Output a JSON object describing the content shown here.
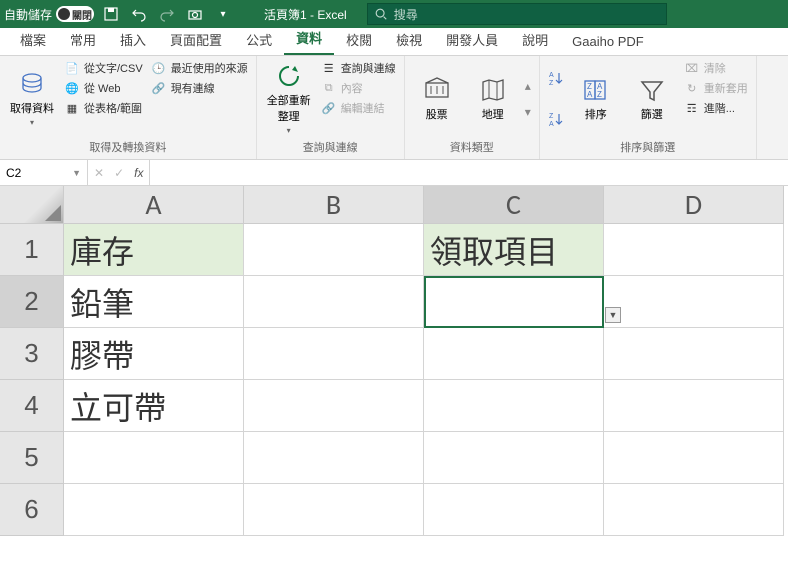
{
  "titlebar": {
    "autosave_label": "自動儲存",
    "autosave_state": "關閉",
    "doc_title": "活頁簿1 - Excel",
    "search_placeholder": "搜尋"
  },
  "tabs": [
    "檔案",
    "常用",
    "插入",
    "頁面配置",
    "公式",
    "資料",
    "校閱",
    "檢視",
    "開發人員",
    "說明",
    "Gaaiho PDF"
  ],
  "active_tab": 5,
  "ribbon": {
    "g1": {
      "big": "取得資料",
      "items": [
        "從文字/CSV",
        "從 Web",
        "從表格/範圍",
        "最近使用的來源",
        "現有連線"
      ],
      "label": "取得及轉換資料"
    },
    "g2": {
      "big": "全部重新整理",
      "items": [
        "查詢與連線",
        "內容",
        "編輯連結"
      ],
      "label": "查詢與連線"
    },
    "g3": {
      "b1": "股票",
      "b2": "地理",
      "label": "資料類型"
    },
    "g4": {
      "big": "排序",
      "big2": "篩選",
      "items": [
        "清除",
        "重新套用",
        "進階..."
      ],
      "label": "排序與篩選"
    }
  },
  "formula": {
    "name_box": "C2",
    "fx": "fx"
  },
  "columns": [
    "A",
    "B",
    "C",
    "D"
  ],
  "selected_col": 2,
  "rows": [
    1,
    2,
    3,
    4,
    5,
    6
  ],
  "selected_row": 1,
  "cells": {
    "A1": "庫存",
    "A2": "鉛筆",
    "A3": "膠帶",
    "A4": "立可帶",
    "C1": "領取項目"
  },
  "active_cell": "C2",
  "green_cells": [
    "A1",
    "C1"
  ]
}
